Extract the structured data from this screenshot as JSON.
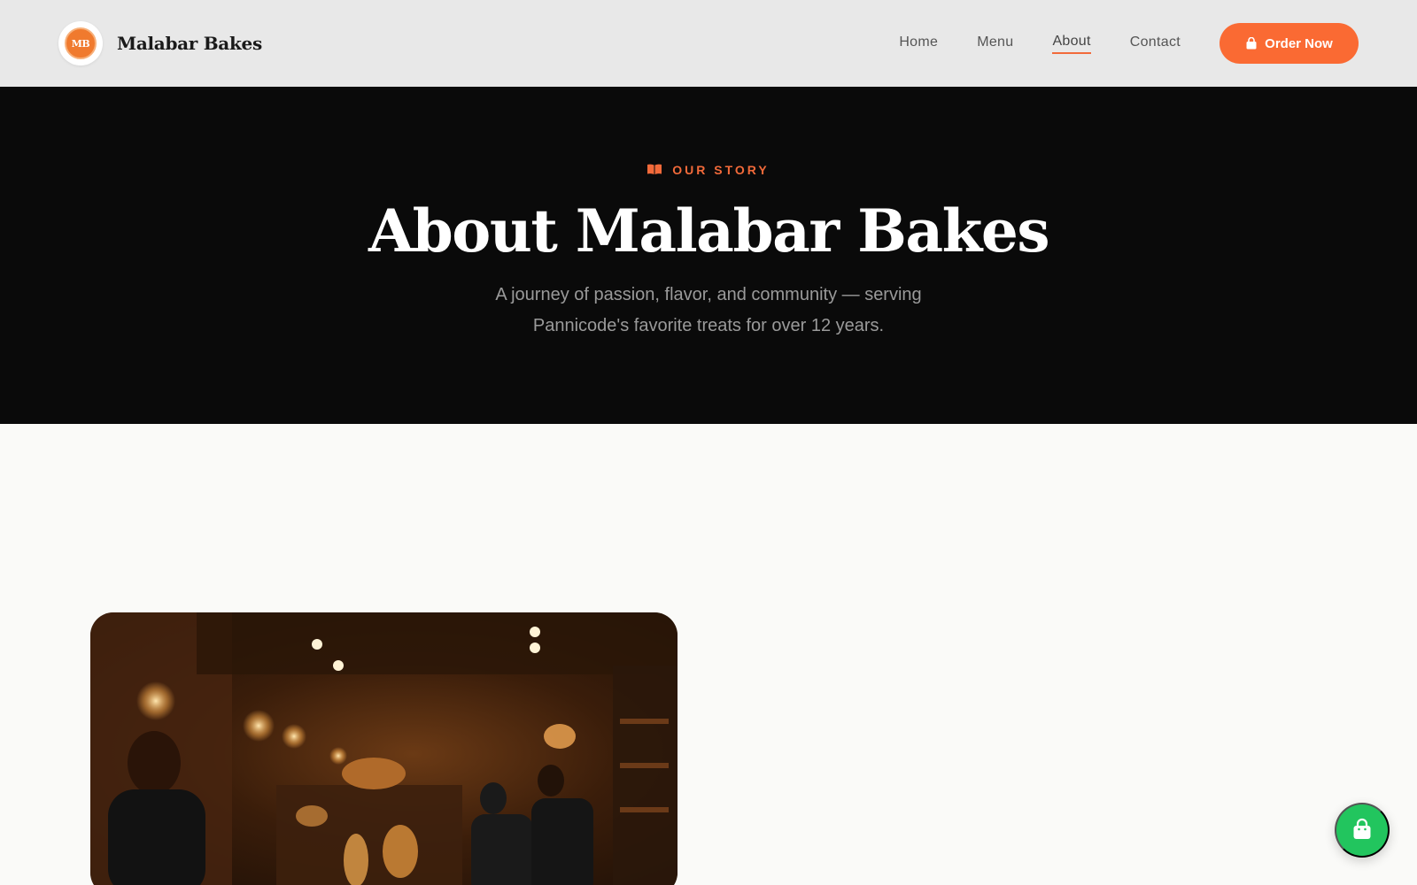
{
  "nav": {
    "brand": "Malabar Bakes",
    "logo_text": "MB",
    "links": [
      "Home",
      "Menu",
      "About",
      "Contact"
    ],
    "active": "About",
    "order_label": "Order Now"
  },
  "hero": {
    "eyebrow": "OUR STORY",
    "title": "About Malabar Bakes",
    "subtitle": "A journey of passion, flavor, and community — serving Pannicode's favorite treats for over 12 years."
  },
  "colors": {
    "accent": "#fa6a33",
    "hero_bg": "#0a0a0a",
    "fab": "#22c55e"
  },
  "icons": {
    "order": "shopping-bag-icon",
    "eyebrow": "book-icon",
    "fab": "shopping-bag-icon"
  }
}
